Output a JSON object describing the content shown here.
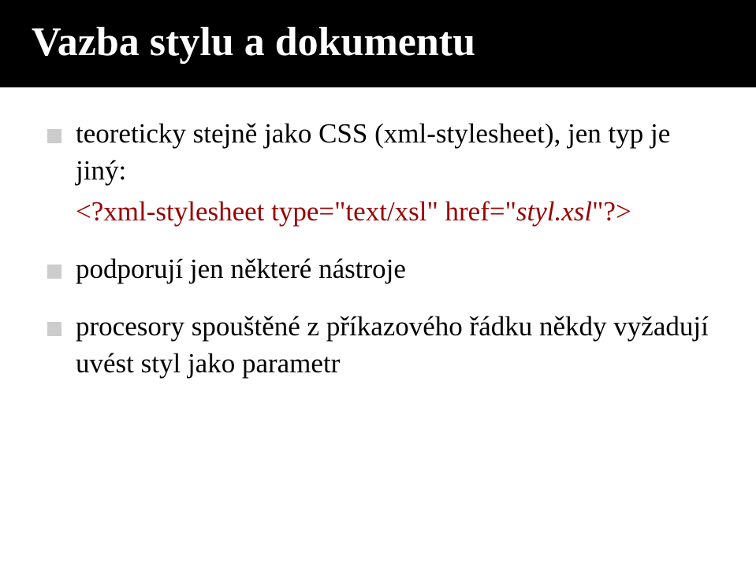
{
  "title": "Vazba stylu a dokumentu",
  "bullets": {
    "b1_text": "teoreticky stejně jako CSS (xml-stylesheet), jen typ je jiný:",
    "b1_code_pre": "<?xml-stylesheet type=\"text/xsl\" href=\"",
    "b1_code_ital": "styl.xsl",
    "b1_code_post": "\"?>",
    "b2": "podporují jen některé nástroje",
    "b3": "procesory spouštěné z příkazového řádku někdy vyžadují uvést styl jako parametr"
  }
}
